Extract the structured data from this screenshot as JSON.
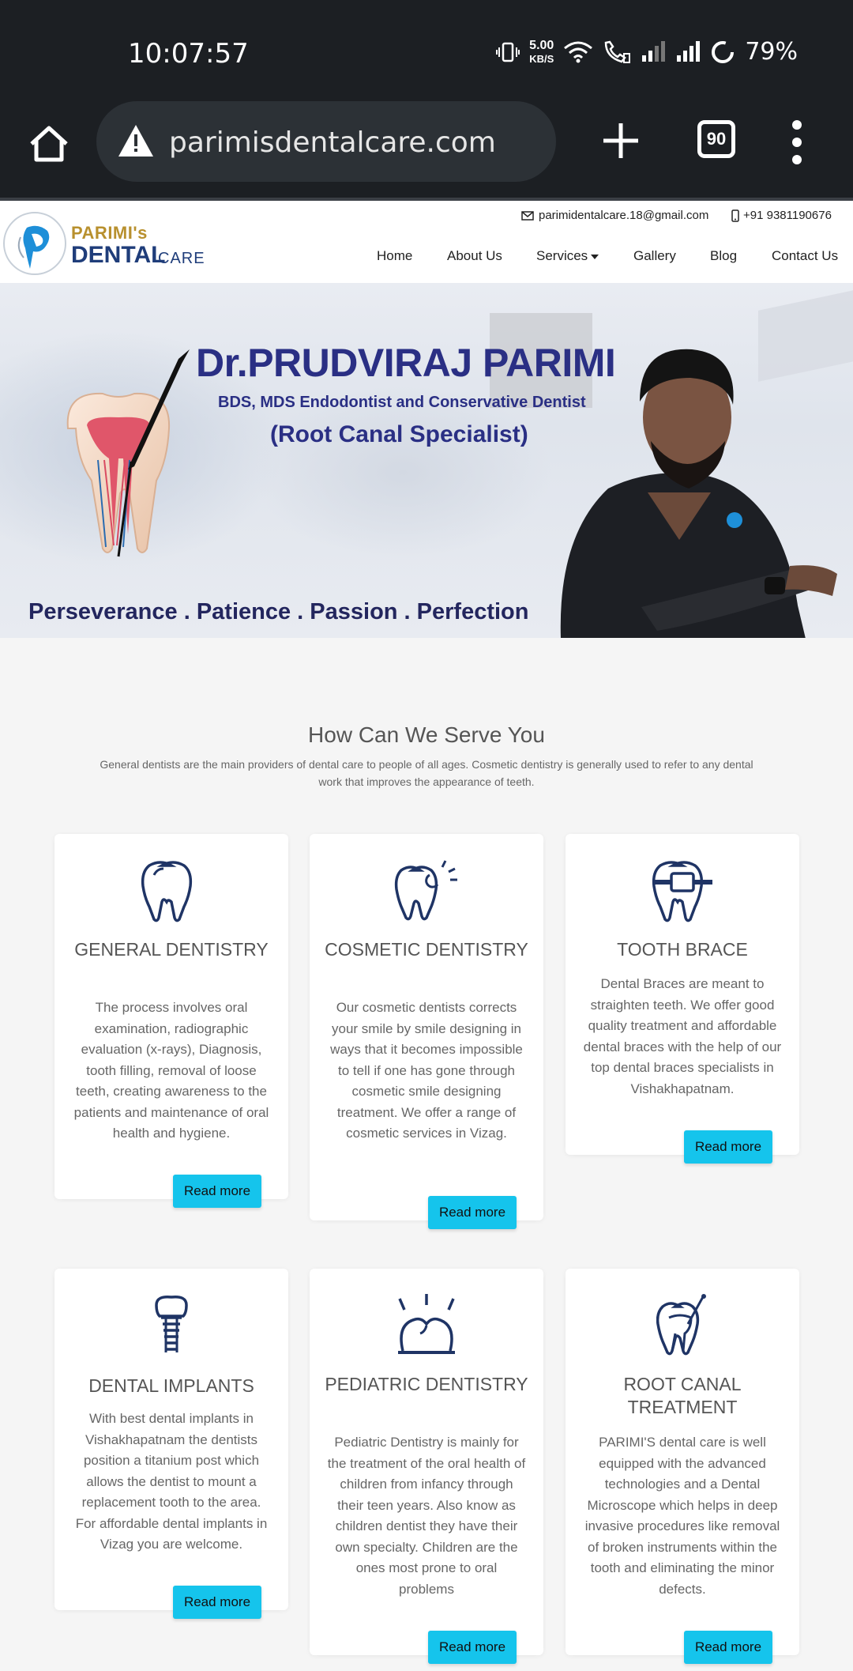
{
  "status_bar": {
    "time": "10:07:57",
    "speed_value": "5.00",
    "speed_unit": "KB/S",
    "battery": "79%"
  },
  "browser": {
    "url": "parimisdentalcare.com",
    "tab_count": "90"
  },
  "header": {
    "logo_name": "PARIMI's",
    "logo_dental": "DENTAL",
    "logo_care": "CARE",
    "email": "parimidentalcare.18@gmail.com",
    "phone": "+91 9381190676",
    "nav": [
      "Home",
      "About Us",
      "Services",
      "Gallery",
      "Blog",
      "Contact Us"
    ]
  },
  "hero": {
    "name": "Dr.PRUDVIRAJ PARIMI",
    "qualifications": "BDS, MDS Endodontist and Conservative Dentist",
    "specialist": "(Root Canal Specialist)",
    "tagline": "Perseverance . Patience . Passion . Perfection"
  },
  "services": {
    "title": "How Can We Serve You",
    "subtitle": "General dentists are the main providers of dental care to people of all ages. Cosmetic dentistry is generally used to refer to any dental work that improves the appearance of teeth.",
    "read_more": "Read more",
    "cards": [
      {
        "icon": "tooth-icon",
        "title": "GENERAL DENTISTRY",
        "text": "The process involves oral examination, radiographic evaluation (x-rays), Diagnosis, tooth filling, removal of loose teeth, creating awareness to the patients and maintenance of oral health and hygiene."
      },
      {
        "icon": "sparkle-tooth-icon",
        "title": "COSMETIC DENTISTRY",
        "text": "Our cosmetic dentists corrects your smile by smile designing in ways that it becomes impossible to tell if one has gone through cosmetic smile designing treatment. We offer a range of cosmetic services in Vizag."
      },
      {
        "icon": "tooth-brace-icon",
        "title": "TOOTH BRACE",
        "text": "Dental Braces are meant to straighten teeth. We offer good quality treatment and affordable dental braces with the help of our top dental braces specialists in Vishakhapatnam."
      },
      {
        "icon": "dental-implant-icon",
        "title": "DENTAL IMPLANTS",
        "text": "With best dental implants in Vishakhapatnam the dentists position a titanium post which allows the dentist to mount a replacement tooth to the area. For affordable dental implants in Vizag you are welcome."
      },
      {
        "icon": "pediatric-tooth-icon",
        "title": "PEDIATRIC DENTISTRY",
        "text": "Pediatric Dentistry is mainly for the treatment of the oral health of children from infancy through their teen years. Also know as children dentist they have their own specialty. Children are the ones most prone to oral problems"
      },
      {
        "icon": "root-canal-icon",
        "title": "ROOT CANAL TREATMENT",
        "text": "PARIMI'S dental care is well equipped with the advanced technologies and a Dental Microscope which helps in deep invasive procedures like removal of broken instruments within the tooth and eliminating the minor defects."
      }
    ]
  }
}
